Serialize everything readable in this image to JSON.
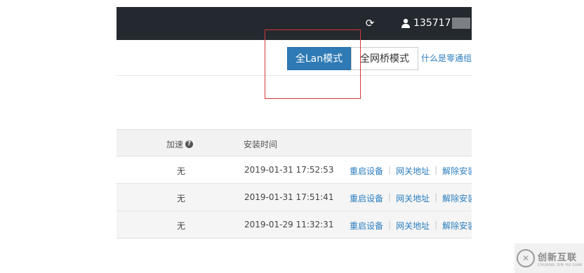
{
  "header": {
    "refresh_icon": "refresh-icon",
    "user_icon": "user-icon",
    "username": "135717"
  },
  "modes": {
    "active_label": "全Lan模式",
    "bridge_label": "全网桥模式",
    "help_link": "什么是零通组"
  },
  "table": {
    "columns": {
      "accel": "加速",
      "install_time": "安装时间"
    },
    "rows": [
      {
        "accel": "无",
        "time": "2019-01-31 17:52:53",
        "actions": [
          "重启设备",
          "网关地址",
          "解除安装"
        ]
      },
      {
        "accel": "无",
        "time": "2019-01-31 17:51:41",
        "actions": [
          "重启设备",
          "网关地址",
          "解除安装"
        ]
      },
      {
        "accel": "无",
        "time": "2019-01-29 11:32:31",
        "actions": [
          "重启设备",
          "网关地址",
          "解除安装"
        ]
      }
    ]
  },
  "watermark": {
    "brand_cn": "创新互联",
    "brand_en": "CHUANG XIN HU LIAN"
  },
  "colors": {
    "topbar": "#23292e",
    "primary": "#2e7ab5",
    "link": "#2a7ec0",
    "highlight": "#d23a3a"
  }
}
